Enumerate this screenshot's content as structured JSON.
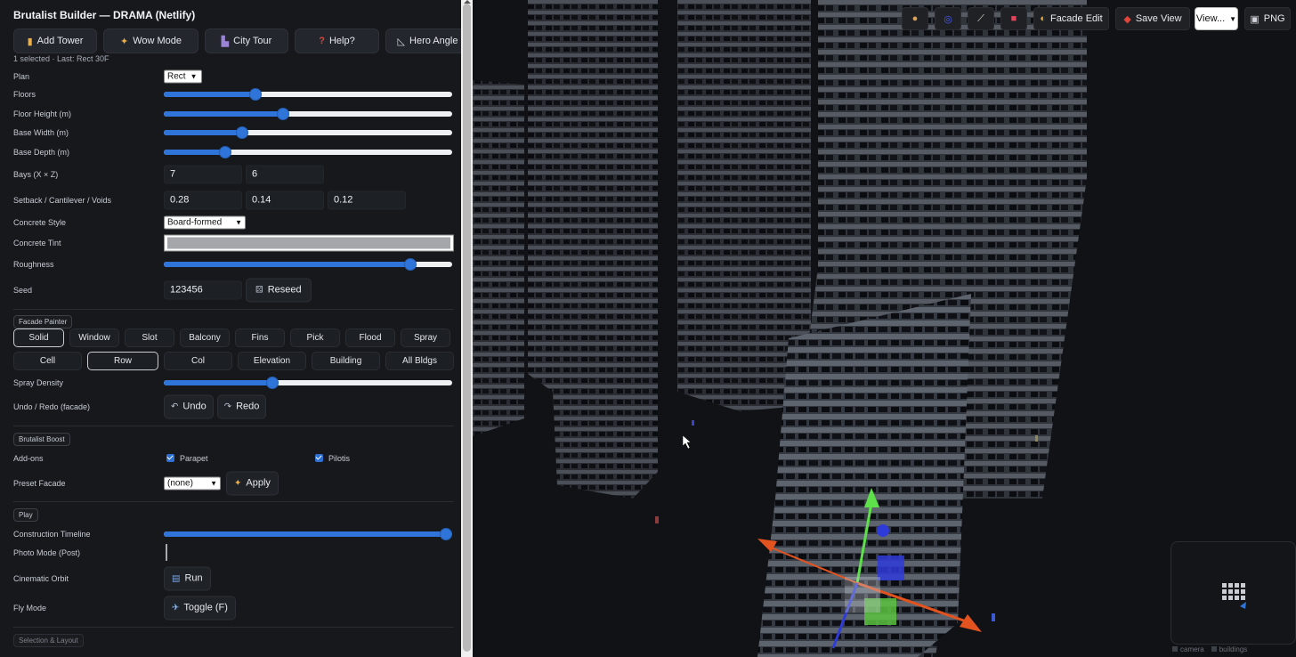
{
  "panel": {
    "title": "Brutalist Builder — DRAMA (Netlify)",
    "top_buttons": [
      {
        "label": "Add Tower",
        "icon": "tower-icon"
      },
      {
        "label": "Wow Mode",
        "icon": "sparkle-icon"
      },
      {
        "label": "City Tour",
        "icon": "cityscape-icon"
      },
      {
        "label": "Help?",
        "icon": "question-icon"
      },
      {
        "label": "Hero Angle",
        "icon": "triangle-ruler-icon"
      }
    ],
    "selection_info": "1 selected · Last: Rect 30F",
    "plan": {
      "label": "Plan",
      "value": "Rect"
    },
    "floors": {
      "label": "Floors",
      "level": 0.31
    },
    "floor_height": {
      "label": "Floor Height (m)",
      "level": 0.41
    },
    "base_width": {
      "label": "Base Width (m)",
      "level": 0.26
    },
    "base_depth": {
      "label": "Base Depth (m)",
      "level": 0.2
    },
    "bays": {
      "label": "Bays (X × Z)",
      "x": "7",
      "z": "6"
    },
    "setback": {
      "label": "Setback / Cantilever / Voids",
      "setback": "0.28",
      "cantilever": "0.14",
      "voids": "0.12"
    },
    "concrete_style": {
      "label": "Concrete Style",
      "value": "Board-formed"
    },
    "concrete_tint": {
      "label": "Concrete Tint",
      "color": "#a4a6a9"
    },
    "roughness": {
      "label": "Roughness",
      "level": 0.87
    },
    "seed": {
      "label": "Seed",
      "value": "123456",
      "reseed_label": "Reseed"
    },
    "facade_painter": {
      "section_label": "Facade Painter",
      "tools": [
        "Solid",
        "Window",
        "Slot",
        "Balcony",
        "Fins",
        "Pick",
        "Flood",
        "Spray"
      ],
      "active_tool": "Solid",
      "scopes": [
        "Cell",
        "Row",
        "Col",
        "Elevation",
        "Building",
        "All Bldgs"
      ],
      "active_scope": "Row",
      "spray_density": {
        "label": "Spray Density",
        "level": 0.37
      },
      "undo_redo": {
        "label": "Undo / Redo (facade)",
        "undo": "Undo",
        "redo": "Redo"
      }
    },
    "brutalist_boost": {
      "section_label": "Brutalist Boost",
      "addons_label": "Add-ons",
      "parapet": {
        "label": "Parapet",
        "checked": true
      },
      "pilotis": {
        "label": "Pilotis",
        "checked": true
      },
      "preset": {
        "label": "Preset Facade",
        "value": "(none)",
        "apply_label": "Apply"
      }
    },
    "play": {
      "section_label": "Play",
      "timeline": {
        "label": "Construction Timeline",
        "level": 1.0
      },
      "photo_mode": {
        "label": "Photo Mode (Post)",
        "checked": false
      },
      "orbit": {
        "label": "Cinematic Orbit",
        "button": "Run"
      },
      "fly": {
        "label": "Fly Mode",
        "button": "Toggle (F)"
      }
    },
    "selection_layout_label": "Selection & Layout"
  },
  "toolbar": {
    "icon_buttons": [
      "cookie-icon",
      "orbit-icon",
      "ruler-icon",
      "eraser-icon"
    ],
    "facade_edit": "Facade Edit",
    "save_view": "Save View",
    "view_select": "View...",
    "png": "PNG"
  },
  "minimap": {
    "legend": [
      "camera",
      "buildings"
    ]
  },
  "colors": {
    "accent": "#2f74d8",
    "panel_bg": "#16181c",
    "viewport_bg": "#111216",
    "gizmo_x": "#e2531f",
    "gizmo_y": "#5de04a",
    "gizmo_z": "#2f3bd9"
  }
}
